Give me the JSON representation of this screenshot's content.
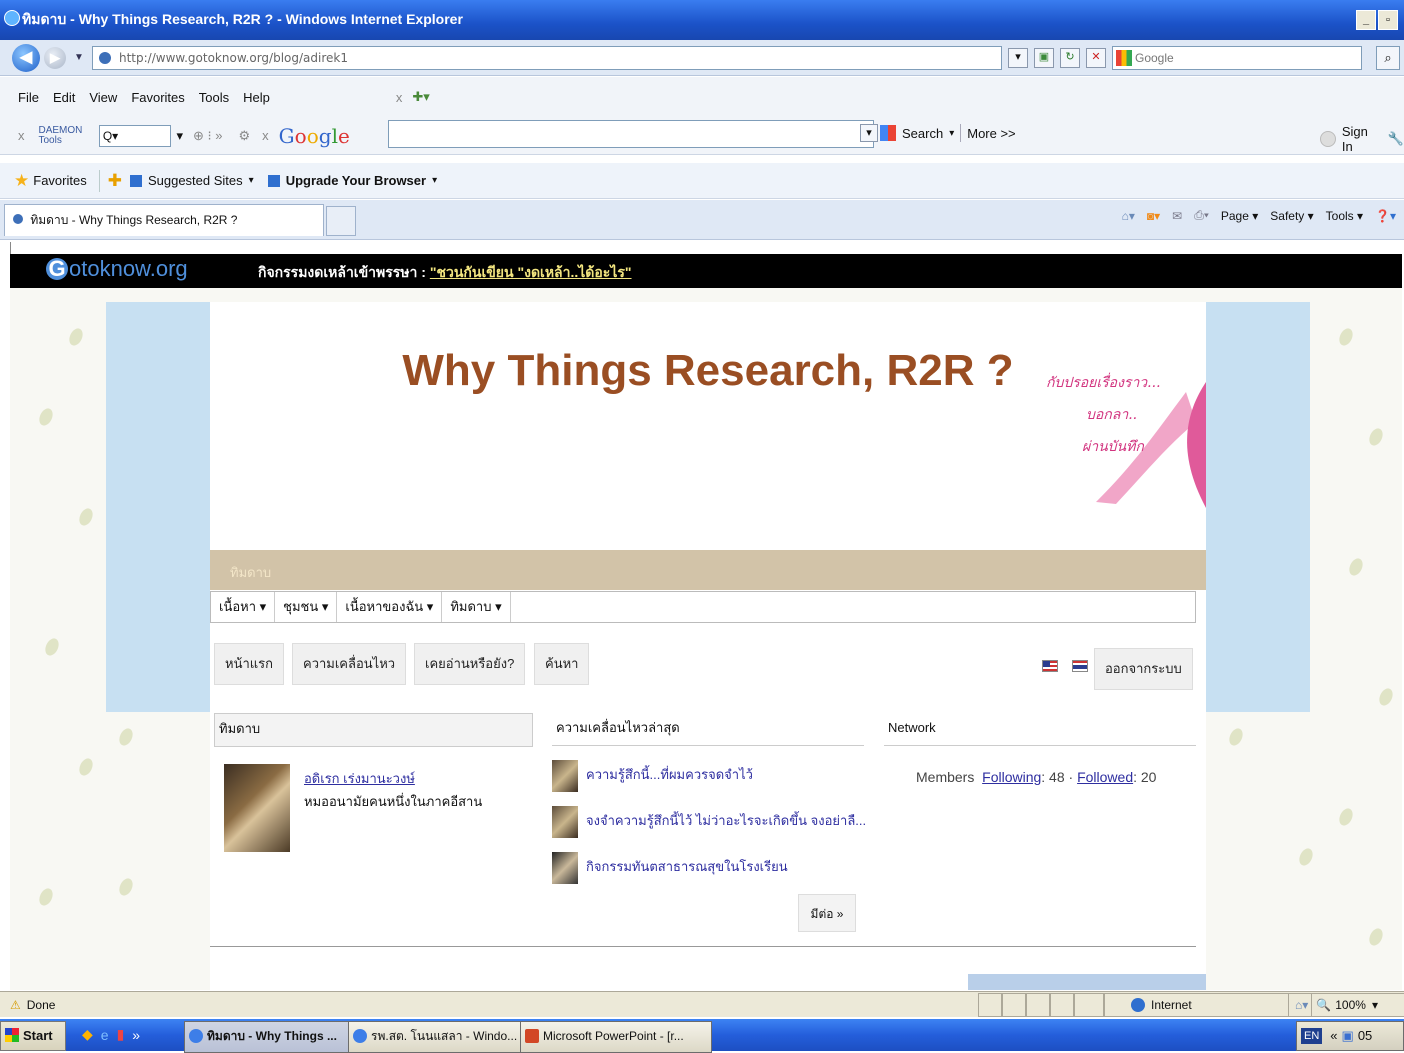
{
  "window": {
    "title": "ทิมดาบ - Why Things Research, R2R ? - Windows Internet Explorer"
  },
  "address": {
    "url": "http://www.gotoknow.org/blog/adirek1",
    "search_placeholder": "Google"
  },
  "menu": [
    "File",
    "Edit",
    "View",
    "Favorites",
    "Tools",
    "Help"
  ],
  "google_toolbar": {
    "daemon": "DAEMON Tools",
    "logo": "Google",
    "search_label": "Search",
    "more_label": "More >>",
    "signin_label": "Sign In"
  },
  "favorites": {
    "favorites_label": "Favorites",
    "suggested_label": "Suggested Sites",
    "upgrade_label": "Upgrade Your Browser"
  },
  "tab": {
    "title": "ทิมดาบ - Why Things Research, R2R ?"
  },
  "commandbar": {
    "page": "Page",
    "safety": "Safety",
    "tools": "Tools"
  },
  "site": {
    "logo_text": "otoknow.org",
    "announce_prefix": "กิจกรรมงดเหล้าเข้าพรรษา :",
    "announce_link": "\"ชวนกันเขียน \"งดเหล้า..ได้อะไร\"",
    "headline": "Why Things Research, R2R ?",
    "ribbon_lines": [
      "กับปรอยเรื่องราว...",
      "บอกลา..",
      "ผ่านบันทึก"
    ],
    "beige_label": "ทิมดาบ",
    "dropdowns": [
      "เนื้อหา ▾",
      "ชุมชน ▾",
      "เนื้อหาของฉัน ▾",
      "ทิมดาบ ▾"
    ],
    "page_buttons": [
      "หน้าแรก",
      "ความเคลื่อนไหว",
      "เคยอ่านหรือยัง?",
      "ค้นหา"
    ],
    "logout_label": "ออกจากระบบ",
    "col_profile": "ทิมดาบ",
    "col_activity": "ความเคลื่อนไหวล่าสุด",
    "col_network": "Network",
    "profile_name": "อดิเรก เร่งมานะวงษ์",
    "profile_desc": "หมออนามัยคนหนึ่งในภาคอีสาน",
    "activities": [
      "ความรู้สึกนี้...ที่ผมควรจดจำไว้",
      "จงจำความรู้สึกนี้ไว้ ไม่ว่าอะไรจะเกิดขึ้น จงอย่าลื...",
      "กิจกรรมทันตสาธารณสุขในโรงเรียน"
    ],
    "more_label": "มีต่อ »",
    "network_members": "Members",
    "network_following_label": "Following",
    "network_following_count": ": 48 ·",
    "network_followed_label": "Followed",
    "network_followed_count": ": 20"
  },
  "status": {
    "left": "Done",
    "zone": "Internet",
    "zoom": "100%"
  },
  "taskbar": {
    "start": "Start",
    "tasks": [
      "ทิมดาบ - Why Things ...",
      "รพ.สต. โนนแสลา - Windo...",
      "Microsoft PowerPoint - [r..."
    ],
    "lang": "EN",
    "clock": "05"
  }
}
